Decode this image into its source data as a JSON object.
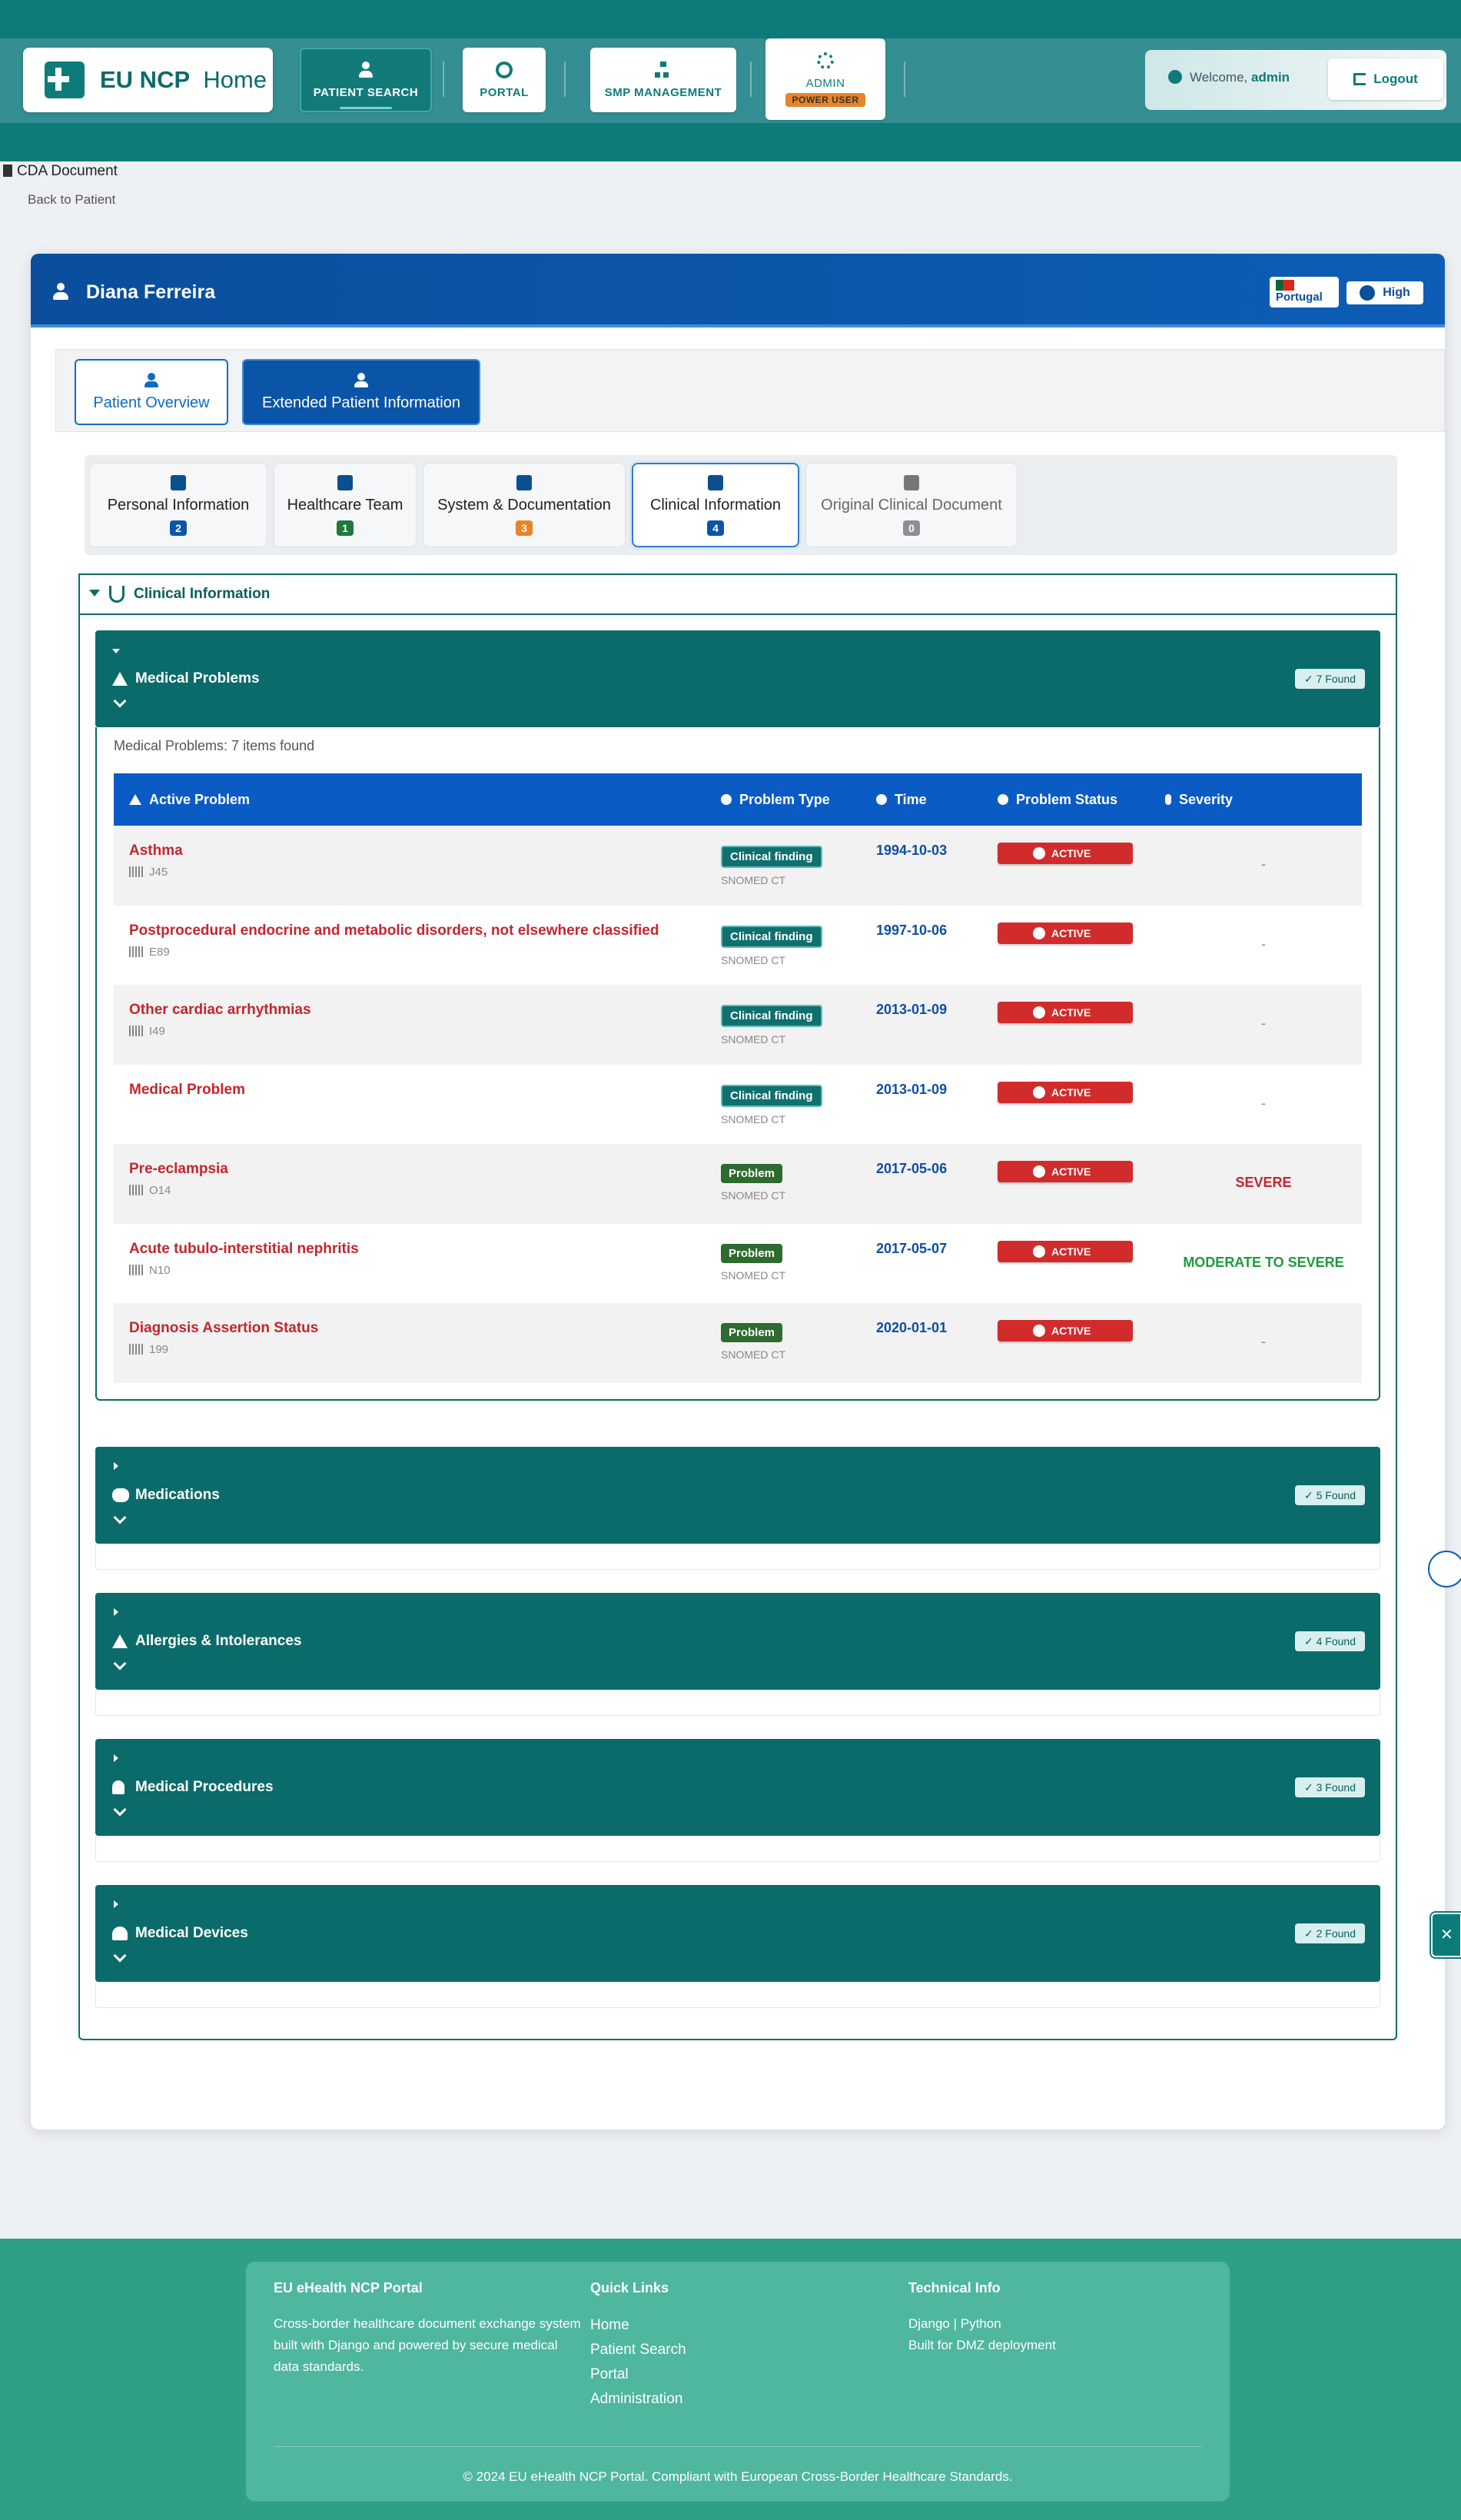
{
  "nav": {
    "brand_strong": "EU NCP",
    "brand_light": "Home",
    "patient_search": "PATIENT SEARCH",
    "portal": "PORTAL",
    "smp": "SMP MANAGEMENT",
    "admin": "ADMIN",
    "power_user": "POWER USER",
    "welcome_prefix": "Welcome,",
    "welcome_user": "admin",
    "logout": "Logout"
  },
  "breadcrumb": {
    "doc_title": "CDA Document",
    "back": "Back to Patient"
  },
  "patient": {
    "name": "Diana Ferreira",
    "country": "Portugal",
    "level": "High"
  },
  "patient_tabs": {
    "overview": "Patient Overview",
    "extended": "Extended Patient Information"
  },
  "sub_tabs": [
    {
      "label": "Personal Information",
      "count": "2",
      "color": "#0b55a8"
    },
    {
      "label": "Healthcare Team",
      "count": "1",
      "color": "#1f7a3a"
    },
    {
      "label": "System & Documentation",
      "count": "3",
      "color": "#e8842a"
    },
    {
      "label": "Clinical Information",
      "count": "4",
      "color": "#0b55a8"
    },
    {
      "label": "Original Clinical Document",
      "count": "0",
      "color": "#8a9096"
    }
  ],
  "clinical": {
    "title": "Clinical Information",
    "sections": [
      {
        "title": "Medical Problems",
        "found": "✓  7 Found"
      },
      {
        "title": "Medications",
        "found": "✓  5 Found"
      },
      {
        "title": "Allergies & Intolerances",
        "found": "✓  4 Found"
      },
      {
        "title": "Medical Procedures",
        "found": "✓  3 Found"
      },
      {
        "title": "Medical Devices",
        "found": "✓  2 Found"
      }
    ],
    "problems_count": "Medical Problems: 7 items found",
    "table_headers": {
      "problem": "Active Problem",
      "type": "Problem Type",
      "time": "Time",
      "status": "Problem Status",
      "severity": "Severity"
    },
    "problems": [
      {
        "name": "Asthma",
        "code": "J45",
        "type": "Clinical finding",
        "system": "SNOMED CT",
        "time": "1994-10-03",
        "status": "ACTIVE",
        "severity": "-"
      },
      {
        "name": "Postprocedural endocrine and metabolic disorders, not elsewhere classified",
        "code": "E89",
        "type": "Clinical finding",
        "system": "SNOMED CT",
        "time": "1997-10-06",
        "status": "ACTIVE",
        "severity": "-"
      },
      {
        "name": "Other cardiac arrhythmias",
        "code": "I49",
        "type": "Clinical finding",
        "system": "SNOMED CT",
        "time": "2013-01-09",
        "status": "ACTIVE",
        "severity": "-"
      },
      {
        "name": "Medical Problem",
        "code": "",
        "type": "Clinical finding",
        "system": "SNOMED CT",
        "time": "2013-01-09",
        "status": "ACTIVE",
        "severity": "-"
      },
      {
        "name": "Pre-eclampsia",
        "code": "O14",
        "type": "Problem",
        "system": "SNOMED CT",
        "time": "2017-05-06",
        "status": "ACTIVE",
        "severity": "SEVERE"
      },
      {
        "name": "Acute tubulo-interstitial nephritis",
        "code": "N10",
        "type": "Problem",
        "system": "SNOMED CT",
        "time": "2017-05-07",
        "status": "ACTIVE",
        "severity": "MODERATE TO SEVERE"
      },
      {
        "name": "Diagnosis Assertion Status",
        "code": "199",
        "type": "Problem",
        "system": "SNOMED CT",
        "time": "2020-01-01",
        "status": "ACTIVE",
        "severity": "-"
      }
    ]
  },
  "colors": {
    "teal": "#0e7b7b",
    "blue": "#0b55a8",
    "active_red": "#d22b2b",
    "severe_red": "#c4262e",
    "moderate_green": "#1e9b3a"
  },
  "footer": {
    "about_title": "EU eHealth NCP Portal",
    "about_text": "Cross-border healthcare document exchange system built with Django and powered by secure medical data standards.",
    "links_title": "Quick Links",
    "links": [
      "Home",
      "Patient Search",
      "Portal",
      "Administration"
    ],
    "tech_title": "Technical Info",
    "tech_1": "Django | Python",
    "tech_2": "Built for DMZ deployment",
    "copyright": "© 2024 EU eHealth NCP Portal. Compliant with European Cross-Border Healthcare Standards."
  }
}
